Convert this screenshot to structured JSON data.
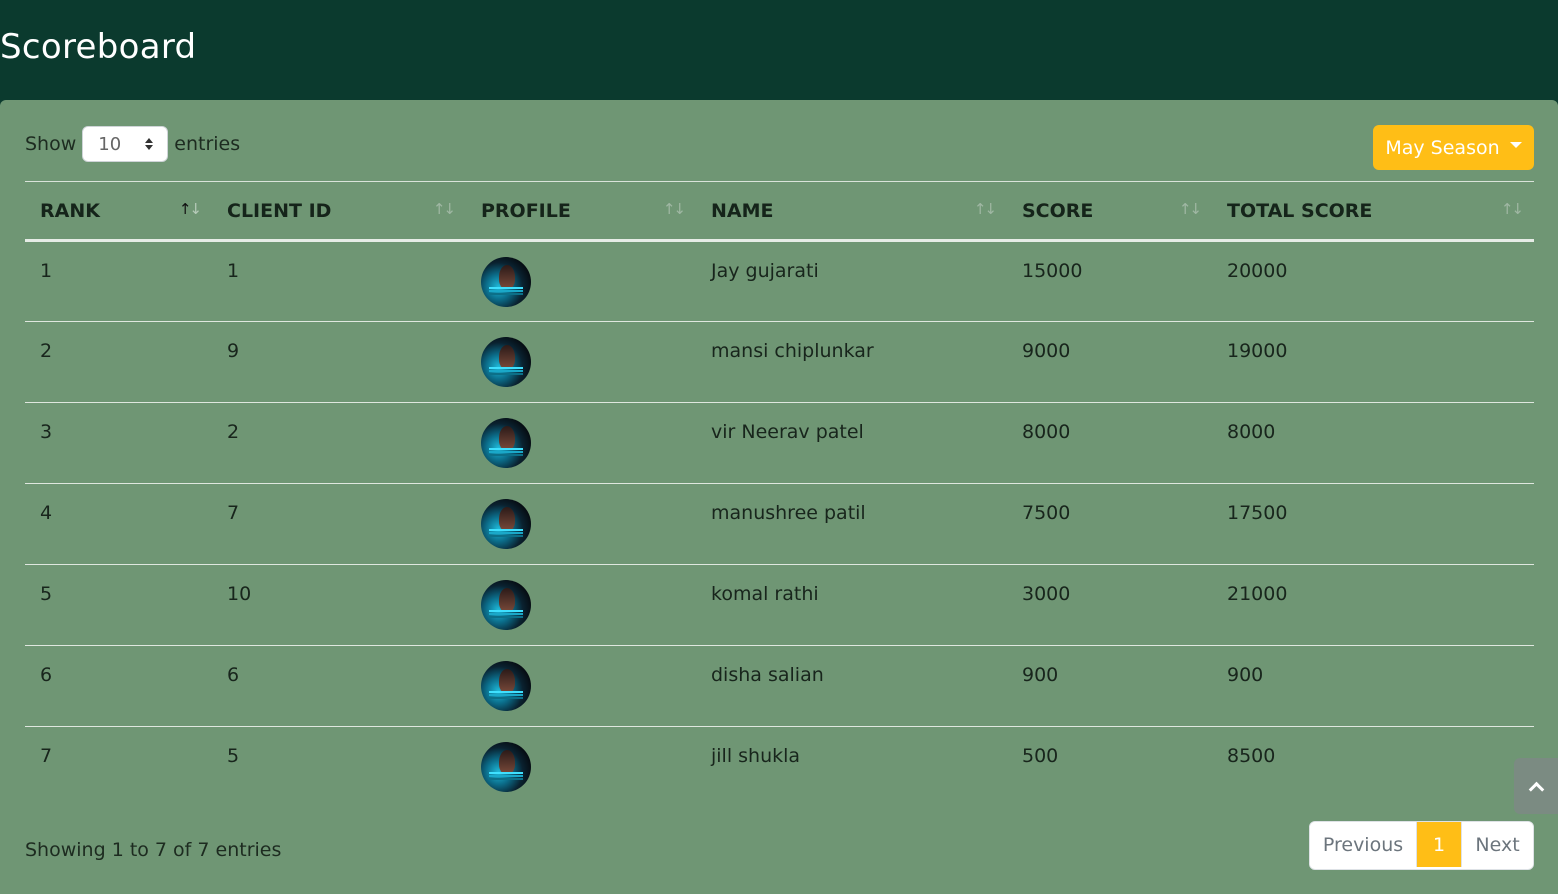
{
  "page": {
    "title": "Scoreboard"
  },
  "controls": {
    "show_label": "Show",
    "entries_label": "entries",
    "page_length": "10",
    "season_label": "May Season"
  },
  "table": {
    "columns": [
      "RANK",
      "CLIENT ID",
      "PROFILE",
      "NAME",
      "SCORE",
      "TOTAL SCORE"
    ],
    "rows": [
      {
        "rank": "1",
        "client_id": "1",
        "name": "Jay gujarati",
        "score": "15000",
        "total_score": "20000"
      },
      {
        "rank": "2",
        "client_id": "9",
        "name": "mansi chiplunkar",
        "score": "9000",
        "total_score": "19000"
      },
      {
        "rank": "3",
        "client_id": "2",
        "name": "vir Neerav patel",
        "score": "8000",
        "total_score": "8000"
      },
      {
        "rank": "4",
        "client_id": "7",
        "name": "manushree patil",
        "score": "7500",
        "total_score": "17500"
      },
      {
        "rank": "5",
        "client_id": "10",
        "name": "komal rathi",
        "score": "3000",
        "total_score": "21000"
      },
      {
        "rank": "6",
        "client_id": "6",
        "name": "disha salian",
        "score": "900",
        "total_score": "900"
      },
      {
        "rank": "7",
        "client_id": "5",
        "name": "jill shukla",
        "score": "500",
        "total_score": "8500"
      }
    ]
  },
  "footer": {
    "info": "Showing 1 to 7 of 7 entries",
    "previous": "Previous",
    "current_page": "1",
    "next": "Next"
  },
  "colors": {
    "header_bg": "#0b3a2e",
    "card_bg": "#6f9674",
    "accent": "#ffbe16"
  },
  "icons": {
    "sort": "sort-arrows-icon",
    "scroll_top": "chevron-up-icon",
    "select_arrows": "up-down-icon"
  }
}
